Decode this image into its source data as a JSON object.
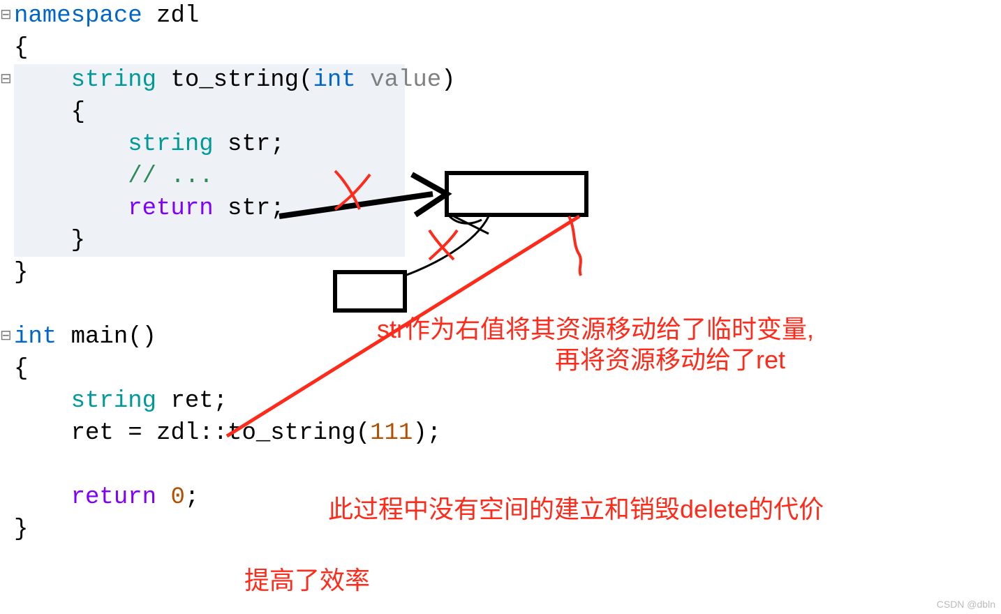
{
  "code": {
    "l1_namespace": "namespace",
    "l1_name": " zdl",
    "l2": "{",
    "l3_type": "    string",
    "l3_fn": " to_string",
    "l3_paren_open": "(",
    "l3_int": "int",
    "l3_param": " value",
    "l3_paren_close": ")",
    "l4": "    {",
    "l5_type": "        string",
    "l5_var": " str;",
    "l6_comment": "        // ...",
    "l7_return": "        return",
    "l7_val": " str;",
    "l8": "    }",
    "l9": "}",
    "blank": "",
    "l11_int": "int",
    "l11_main": " main()",
    "l12": "{",
    "l13_type": "    string",
    "l13_var": " ret;",
    "l14_ret": "    ret ",
    "l14_eq": "=",
    "l14_call": " zdl::to_string(",
    "l14_arg": "111",
    "l14_close": ");",
    "l15_return": "    return",
    "l15_val": " ",
    "l15_zero": "0",
    "l15_semi": ";",
    "l16": "}"
  },
  "annotations": {
    "move1": "str作为右值将其资源移动给了临时变量,",
    "move2": "再将资源移动给了ret",
    "no_cost": "此过程中没有空间的建立和销毁delete的代价",
    "efficiency": "提高了效率"
  },
  "watermark": "CSDN @dbln"
}
